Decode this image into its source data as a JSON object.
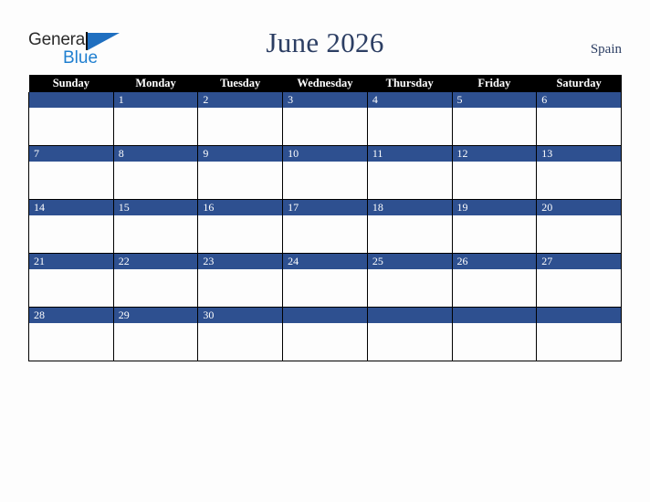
{
  "brand": {
    "line1": "General",
    "line2": "Blue",
    "triangle_color": "#1f6fc0",
    "line1_color": "#2b2b2b",
    "line2_color": "#1f7fd0"
  },
  "header": {
    "title": "June 2026",
    "locale": "Spain",
    "title_color": "#2c3e63"
  },
  "calendar": {
    "weekday_headers": [
      "Sunday",
      "Monday",
      "Tuesday",
      "Wednesday",
      "Thursday",
      "Friday",
      "Saturday"
    ],
    "header_bg": "#000000",
    "header_text_color": "#ffffff",
    "daynum_band_color": "#2e5090",
    "daynum_text_color": "#ffffff",
    "cell_bg": "#fdfdfd",
    "grid_line_color": "#000000",
    "weeks": [
      [
        "",
        "1",
        "2",
        "3",
        "4",
        "5",
        "6"
      ],
      [
        "7",
        "8",
        "9",
        "10",
        "11",
        "12",
        "13"
      ],
      [
        "14",
        "15",
        "16",
        "17",
        "18",
        "19",
        "20"
      ],
      [
        "21",
        "22",
        "23",
        "24",
        "25",
        "26",
        "27"
      ],
      [
        "28",
        "29",
        "30",
        "",
        "",
        "",
        ""
      ]
    ]
  }
}
